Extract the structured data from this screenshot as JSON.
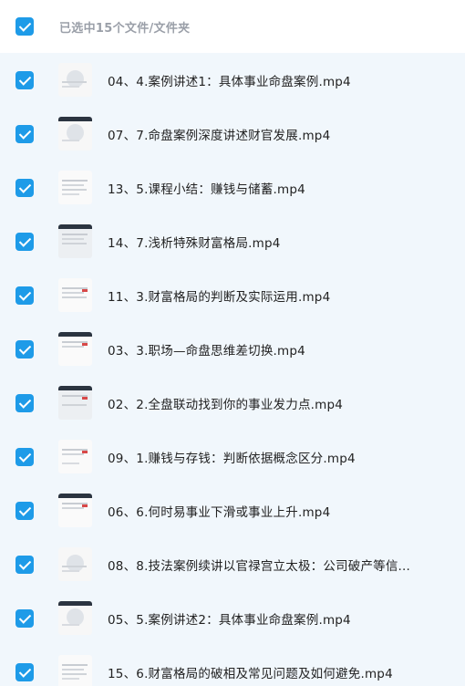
{
  "header": {
    "title": "已选中15个文件/文件夹"
  },
  "files": [
    {
      "name": "04、4.案例讲述1：具体事业命盘案例.mp4"
    },
    {
      "name": "07、7.命盘案例深度讲述财官发展.mp4"
    },
    {
      "name": "13、5.课程小结：赚钱与储蓄.mp4"
    },
    {
      "name": "14、7.浅析特殊财富格局.mp4"
    },
    {
      "name": "11、3.财富格局的判断及实际运用.mp4"
    },
    {
      "name": "03、3.职场—命盘思维差切换.mp4"
    },
    {
      "name": "02、2.全盘联动找到你的事业发力点.mp4"
    },
    {
      "name": "09、1.赚钱与存钱：判断依据概念区分.mp4"
    },
    {
      "name": "06、6.何时易事业下滑或事业上升.mp4"
    },
    {
      "name": "08、8.技法案例续讲以官禄宫立太极：公司破产等信..."
    },
    {
      "name": "05、5.案例讲述2：具体事业命盘案例.mp4"
    },
    {
      "name": "15、6.财富格局的破相及常见问题及如何避免.mp4"
    }
  ],
  "colors": {
    "checkbox": "#1e9be8",
    "list_background": "#f1f7fc",
    "header_text": "#9a9fa8"
  }
}
